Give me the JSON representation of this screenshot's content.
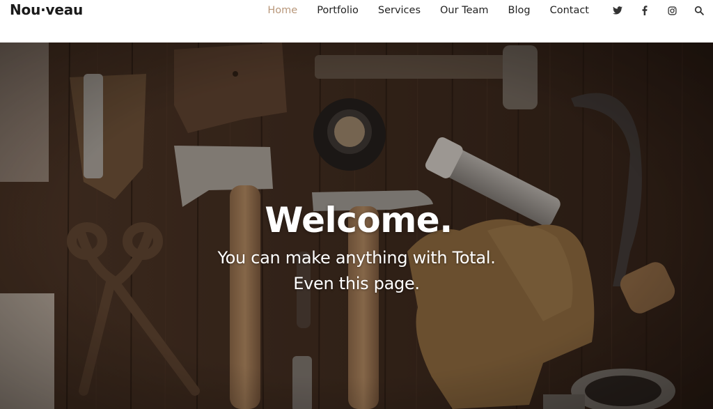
{
  "site": {
    "logo": "Nou·veau"
  },
  "nav": {
    "items": [
      {
        "label": "Home",
        "active": true
      },
      {
        "label": "Portfolio",
        "active": false
      },
      {
        "label": "Services",
        "active": false
      },
      {
        "label": "Our Team",
        "active": false
      },
      {
        "label": "Blog",
        "active": false
      },
      {
        "label": "Contact",
        "active": false
      }
    ],
    "social_icons": [
      "twitter-icon",
      "facebook-icon",
      "instagram-icon",
      "search-icon"
    ]
  },
  "hero": {
    "title": "Welcome.",
    "subtitle_line1": "You can make anything with Total.",
    "subtitle_line2": "Even this page.",
    "background_image": "tools on a wooden table"
  },
  "colors": {
    "accent_active_nav": "#b8977a",
    "text_dark": "#222222",
    "hero_text": "#ffffff"
  }
}
